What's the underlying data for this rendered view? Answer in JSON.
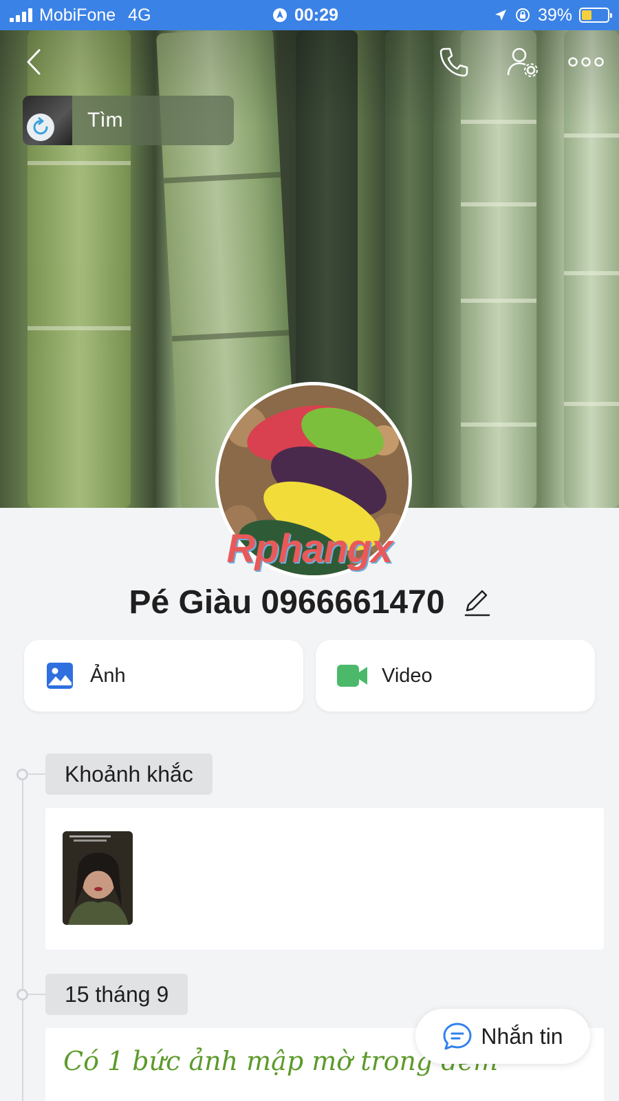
{
  "status_bar": {
    "carrier": "MobiFone",
    "network": "4G",
    "time": "00:29",
    "battery": "39%",
    "battery_level": 0.39
  },
  "header": {
    "find_label": "Tìm"
  },
  "profile": {
    "name": "Pé Giàu 0966661470",
    "watermark": "Rphangx"
  },
  "media": {
    "photo_label": "Ảnh",
    "video_label": "Video"
  },
  "timeline": {
    "moments_tag": "Khoảnh khắc",
    "date_tag": "15 tháng 9",
    "post_text": "Có 1 bức ảnh mập mờ trong đêm"
  },
  "actions": {
    "message_label": "Nhắn tin"
  },
  "colors": {
    "status_bar": "#3b82e6",
    "photo_icon": "#2f6fe0",
    "video_icon": "#4cb86a",
    "message_icon": "#2f80ed",
    "post_text": "#5c9a2a"
  },
  "icons": [
    "back-icon",
    "phone-icon",
    "user-settings-icon",
    "more-icon",
    "refresh-icon",
    "image-icon",
    "video-camera-icon",
    "pencil-icon",
    "chat-icon"
  ]
}
